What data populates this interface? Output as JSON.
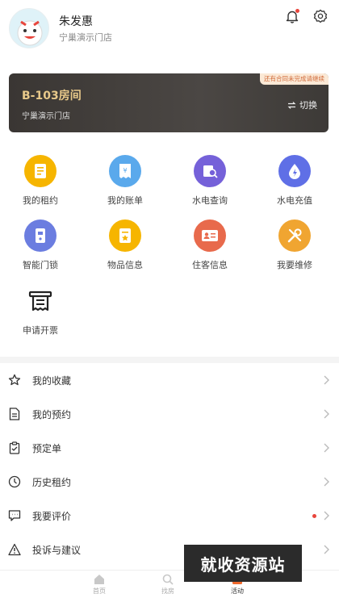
{
  "user": {
    "name": "朱发惠",
    "store": "宁巢演示门店"
  },
  "room": {
    "number": "B-103房间",
    "store": "宁巢演示门店",
    "tip": "还有合同未完成请继续",
    "switch_label": "切换"
  },
  "grid": [
    {
      "label": "我的租约",
      "icon": "contract-icon",
      "color": "#f6b500"
    },
    {
      "label": "我的账单",
      "icon": "bill-icon",
      "color": "#5aa9ec"
    },
    {
      "label": "水电查询",
      "icon": "utility-query-icon",
      "color": "#7561d9"
    },
    {
      "label": "水电充值",
      "icon": "utility-recharge-icon",
      "color": "#5f6fe6"
    },
    {
      "label": "智能门锁",
      "icon": "smart-lock-icon",
      "color": "#6b7de0"
    },
    {
      "label": "物品信息",
      "icon": "item-info-icon",
      "color": "#f6b500"
    },
    {
      "label": "住客信息",
      "icon": "guest-info-icon",
      "color": "#e86a4c"
    },
    {
      "label": "我要维修",
      "icon": "repair-icon",
      "color": "#f0a531"
    },
    {
      "label": "申请开票",
      "icon": "invoice-icon",
      "color": "#333333"
    }
  ],
  "menu": [
    {
      "label": "我的收藏",
      "icon": "star-icon"
    },
    {
      "label": "我的预约",
      "icon": "document-icon"
    },
    {
      "label": "预定单",
      "icon": "clipboard-icon"
    },
    {
      "label": "历史租约",
      "icon": "clock-icon"
    },
    {
      "label": "我要评价",
      "icon": "chat-icon",
      "has_dot": true
    },
    {
      "label": "投诉与建议",
      "icon": "warning-icon"
    }
  ],
  "tabbar": [
    {
      "label": "首页",
      "icon": "home-icon"
    },
    {
      "label": "找房",
      "icon": "search-icon"
    },
    {
      "label": "活动",
      "icon": "activity-icon",
      "active": true
    }
  ],
  "watermark": "就收资源站",
  "colors": {
    "accent": "#e8c98a",
    "dot": "#e8453c",
    "brand_orange": "#f06a2e"
  }
}
